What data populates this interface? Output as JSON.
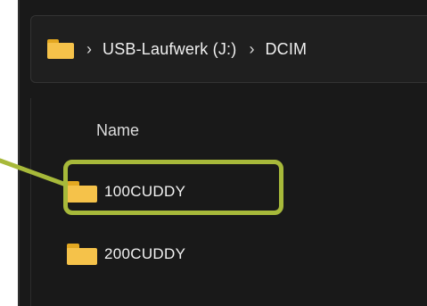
{
  "breadcrumb": {
    "separator": "›",
    "items": [
      "USB-Laufwerk (J:)",
      "DCIM"
    ]
  },
  "file_list": {
    "column_header": "Name",
    "items": [
      {
        "name": "100CUDDY",
        "highlighted": true
      },
      {
        "name": "200CUDDY",
        "highlighted": false
      }
    ]
  },
  "colors": {
    "background": "#191919",
    "folder": "#f5c24a",
    "highlight": "#a7b93a"
  },
  "icons": {
    "address_icon": "folder-icon",
    "item_icon": "folder-icon"
  }
}
